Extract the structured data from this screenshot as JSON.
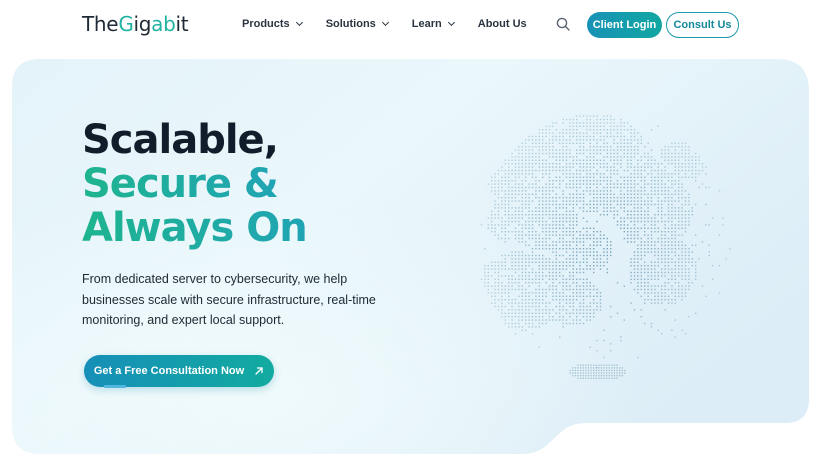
{
  "brand": {
    "logo_text_prefix": "The",
    "logo_text_g": "G",
    "logo_text_mid": "ig",
    "logo_text_ab": "ab",
    "logo_text_suffix": "it"
  },
  "nav": {
    "items": [
      {
        "label": "Products",
        "has_dropdown": true
      },
      {
        "label": "Solutions",
        "has_dropdown": true
      },
      {
        "label": "Learn",
        "has_dropdown": true
      },
      {
        "label": "About Us",
        "has_dropdown": false
      }
    ],
    "search_icon": "search-icon"
  },
  "header_buttons": {
    "client_login": "Client Login",
    "consult_us": "Consult Us"
  },
  "hero": {
    "headline_line1": "Scalable,",
    "headline_line2": "Secure &",
    "headline_line3": "Always On",
    "subtext": "From dedicated server to cybersecurity, we help businesses scale with secure infrastructure, real-time monitoring, and expert local support.",
    "cta_label": "Get a Free Consultation Now",
    "cta_icon": "arrow-up-right-icon",
    "illustration": "dotted-globe"
  },
  "colors": {
    "accent_teal": "#1fa6a5",
    "accent_blue": "#1792b6",
    "headline_dark": "#121d2b",
    "hero_bg": "#e2f2f9"
  }
}
